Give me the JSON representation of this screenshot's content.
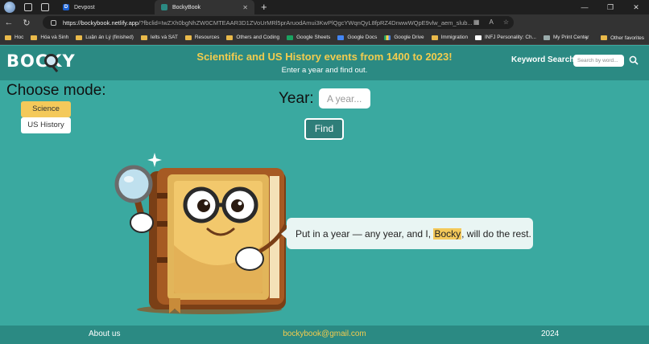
{
  "browser": {
    "tabs": [
      {
        "label": "Devpost",
        "favicon": "D"
      },
      {
        "label": "BockyBook",
        "favicon": ""
      }
    ],
    "url_host": "https://bockybook.netlify.app",
    "url_rest": "/?fbclid=IwZXh0bgNhZW0CMTEAAR3D1ZVoUrMRl5prAruodAmui3KwPlQgcYWqnQyL8fpRZ4DnwwWQpE9vlw_aem_slub...",
    "bookmarks": [
      {
        "label": "Hoc",
        "icon": "folder-icon",
        "kind": "folder"
      },
      {
        "label": "Hóa và Sinh",
        "icon": "folder-icon",
        "kind": "folder"
      },
      {
        "label": "Luận án Lý (finished)",
        "icon": "folder-icon",
        "kind": "folder"
      },
      {
        "label": "Ielts và SAT",
        "icon": "folder-icon",
        "kind": "folder"
      },
      {
        "label": "Resources",
        "icon": "folder-icon",
        "kind": "folder"
      },
      {
        "label": "Others and Coding",
        "icon": "folder-icon",
        "kind": "folder"
      },
      {
        "label": "Google Sheets",
        "icon": "google-sheets-icon",
        "kind": "g"
      },
      {
        "label": "Google Docs",
        "icon": "google-docs-icon",
        "kind": "b"
      },
      {
        "label": "Google Drive",
        "icon": "google-drive-icon",
        "kind": "d"
      },
      {
        "label": "Immigration",
        "icon": "folder-icon",
        "kind": "folder"
      },
      {
        "label": "INFJ Personality: Ch...",
        "icon": "website-icon",
        "kind": "w"
      },
      {
        "label": "My Print Center",
        "icon": "printer-icon",
        "kind": "p"
      }
    ],
    "other_favorites": "Other favorites"
  },
  "header": {
    "logo": "BOCKY",
    "title": "Scientific and US History events from 1400 to 2023!",
    "subtitle": "Enter a year and find out.",
    "keyword_label": "Keyword Search:",
    "keyword_placeholder": "Search by word..."
  },
  "mode": {
    "title": "Choose mode:",
    "options": [
      "Science",
      "US History"
    ],
    "selected": "Science"
  },
  "search": {
    "year_label": "Year:",
    "year_placeholder": "A year...",
    "find_label": "Find"
  },
  "bubble": {
    "before": "Put in a year — any year, and I, ",
    "highlight": "Bocky",
    "after": ", will do the rest."
  },
  "footer": {
    "about": "About us",
    "email": "bockybook@gmail.com",
    "year": "2024"
  },
  "colors": {
    "page_bg": "#3aa9a0",
    "header_bg": "#2b8a83",
    "accent_yellow": "#f4c95a"
  }
}
